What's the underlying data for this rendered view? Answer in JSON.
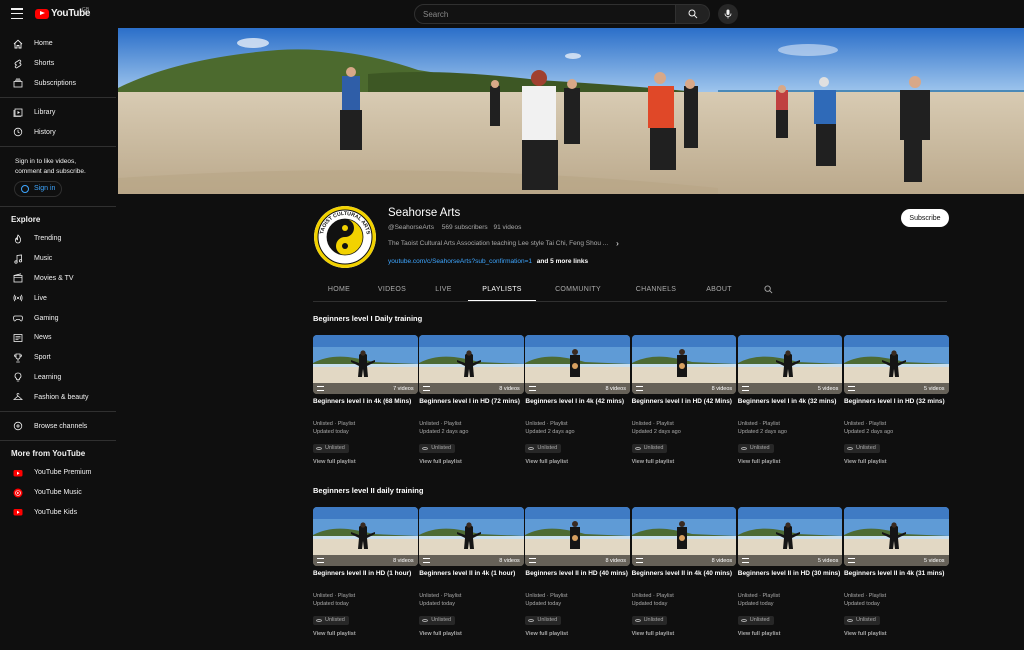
{
  "topbar": {
    "logo_text": "YouTube",
    "logo_region": "GB",
    "search_placeholder": "Search"
  },
  "sidebar": {
    "main": [
      {
        "label": "Home",
        "icon": "home-icon"
      },
      {
        "label": "Shorts",
        "icon": "shorts-icon"
      },
      {
        "label": "Subscriptions",
        "icon": "subscriptions-icon"
      }
    ],
    "library": [
      {
        "label": "Library",
        "icon": "library-icon"
      },
      {
        "label": "History",
        "icon": "history-icon"
      }
    ],
    "signin_text": "Sign in to like videos, comment and subscribe.",
    "signin_label": "Sign in",
    "explore_heading": "Explore",
    "explore": [
      {
        "label": "Trending",
        "icon": "trending-icon"
      },
      {
        "label": "Music",
        "icon": "music-icon"
      },
      {
        "label": "Movies & TV",
        "icon": "movies-icon"
      },
      {
        "label": "Live",
        "icon": "live-icon"
      },
      {
        "label": "Gaming",
        "icon": "gaming-icon"
      },
      {
        "label": "News",
        "icon": "news-icon"
      },
      {
        "label": "Sport",
        "icon": "sport-icon"
      },
      {
        "label": "Learning",
        "icon": "learning-icon"
      },
      {
        "label": "Fashion & beauty",
        "icon": "fashion-icon"
      }
    ],
    "browse_channels": "Browse channels",
    "more_heading": "More from YouTube",
    "more": [
      {
        "label": "YouTube Premium",
        "icon": "youtube-premium-icon"
      },
      {
        "label": "YouTube Music",
        "icon": "youtube-music-icon"
      },
      {
        "label": "YouTube Kids",
        "icon": "youtube-kids-icon"
      }
    ]
  },
  "channel": {
    "name": "Seahorse Arts",
    "handle": "@SeahorseArts",
    "subscribers": "569 subscribers",
    "videos": "91 videos",
    "description": "The Taoist Cultural Arts Association teaching Lee style Tai Chi, Feng Shou ...",
    "link_url": "youtube.com/c/SeahorseArts?sub_confirmation=1",
    "link_more": "and 5 more links",
    "subscribe_label": "Subscribe",
    "avatar_text": "TAOIST CULTURAL ARTS ASSOCIATION"
  },
  "tabs": [
    {
      "label": "HOME",
      "active": false
    },
    {
      "label": "VIDEOS",
      "active": false
    },
    {
      "label": "LIVE",
      "active": false
    },
    {
      "label": "PLAYLISTS",
      "active": true
    },
    {
      "label": "COMMUNITY",
      "active": false
    },
    {
      "label": "CHANNELS",
      "active": false
    },
    {
      "label": "ABOUT",
      "active": false
    }
  ],
  "shelves": [
    {
      "title": "Beginners level I Daily training",
      "cards": [
        {
          "title": "Beginners level I in 4k (68 Mins)",
          "count": "7 videos",
          "meta1": "Unlisted · Playlist",
          "meta2": "Updated today",
          "badge": "Unlisted",
          "action": "View full playlist"
        },
        {
          "title": "Beginners level I in HD (72 mins)",
          "count": "8 videos",
          "meta1": "Unlisted · Playlist",
          "meta2": "Updated 2 days ago",
          "badge": "Unlisted",
          "action": "View full playlist"
        },
        {
          "title": "Beginners level I in 4k (42 mins)",
          "count": "8 videos",
          "meta1": "Unlisted · Playlist",
          "meta2": "Updated 2 days ago",
          "badge": "Unlisted",
          "action": "View full playlist"
        },
        {
          "title": "Beginners level I in HD (42 Mins)",
          "count": "8 videos",
          "meta1": "Unlisted · Playlist",
          "meta2": "Updated 2 days ago",
          "badge": "Unlisted",
          "action": "View full playlist"
        },
        {
          "title": "Beginners level I in 4k (32 mins)",
          "count": "5 videos",
          "meta1": "Unlisted · Playlist",
          "meta2": "Updated 2 days ago",
          "badge": "Unlisted",
          "action": "View full playlist"
        },
        {
          "title": "Beginners level I in HD (32 mins)",
          "count": "5 videos",
          "meta1": "Unlisted · Playlist",
          "meta2": "Updated 2 days ago",
          "badge": "Unlisted",
          "action": "View full playlist"
        }
      ]
    },
    {
      "title": "Beginners level II daily training",
      "cards": [
        {
          "title": "Beginners level II in HD (1 hour)",
          "count": "8 videos",
          "meta1": "Unlisted · Playlist",
          "meta2": "Updated today",
          "badge": "Unlisted",
          "action": "View full playlist"
        },
        {
          "title": "Beginners level II in 4k (1 hour)",
          "count": "8 videos",
          "meta1": "Unlisted · Playlist",
          "meta2": "Updated today",
          "badge": "Unlisted",
          "action": "View full playlist"
        },
        {
          "title": "Beginners level II in HD (40 mins)",
          "count": "8 videos",
          "meta1": "Unlisted · Playlist",
          "meta2": "Updated today",
          "badge": "Unlisted",
          "action": "View full playlist"
        },
        {
          "title": "Beginners level II in 4k (40 mins)",
          "count": "8 videos",
          "meta1": "Unlisted · Playlist",
          "meta2": "Updated today",
          "badge": "Unlisted",
          "action": "View full playlist"
        },
        {
          "title": "Beginners level II in HD (30 mins)",
          "count": "5 videos",
          "meta1": "Unlisted · Playlist",
          "meta2": "Updated today",
          "badge": "Unlisted",
          "action": "View full playlist"
        },
        {
          "title": "Beginners level II in 4k (31 mins)",
          "count": "5 videos",
          "meta1": "Unlisted · Playlist",
          "meta2": "Updated today",
          "badge": "Unlisted",
          "action": "View full playlist"
        }
      ]
    }
  ],
  "colors": {
    "background": "#0f0f0f",
    "accent_link": "#3ea6ff",
    "brand_red": "#ff0000"
  }
}
